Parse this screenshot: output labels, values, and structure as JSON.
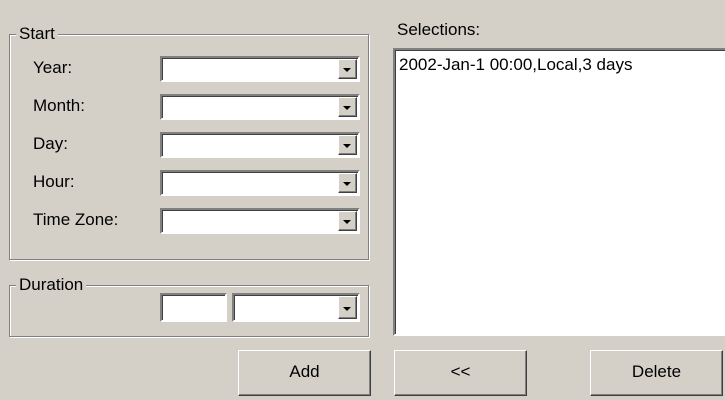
{
  "start": {
    "title": "Start",
    "fields": [
      {
        "label": "Year:",
        "value": ""
      },
      {
        "label": "Month:",
        "value": ""
      },
      {
        "label": "Day:",
        "value": ""
      },
      {
        "label": "Hour:",
        "value": ""
      },
      {
        "label": "Time Zone:",
        "value": ""
      }
    ]
  },
  "duration": {
    "title": "Duration",
    "amount": "",
    "unit": ""
  },
  "selections": {
    "label": "Selections:",
    "items": [
      "2002-Jan-1 00:00,Local,3 days"
    ]
  },
  "buttons": {
    "add": "Add",
    "move_left": "<<",
    "delete": "Delete"
  }
}
